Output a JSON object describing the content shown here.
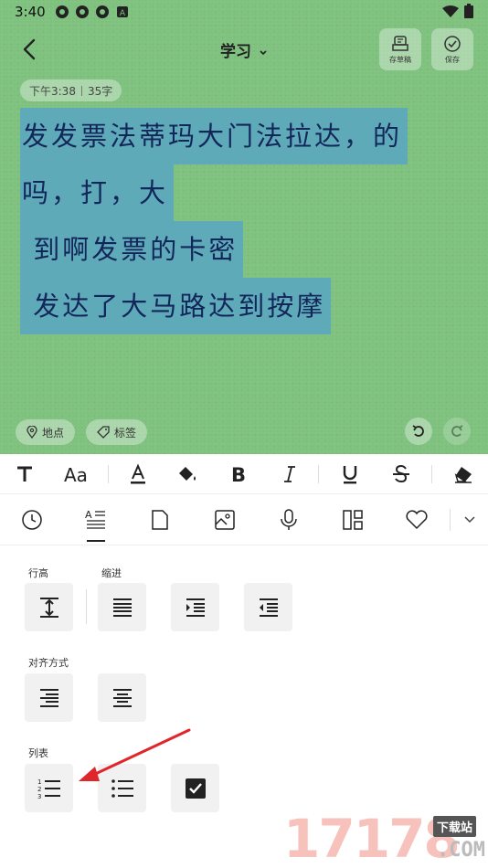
{
  "status_bar": {
    "time": "3:40"
  },
  "header": {
    "title": "学习",
    "draft_label": "存草稿",
    "save_label": "保存"
  },
  "note": {
    "time": "下午3:38",
    "char_count": "35字",
    "lines": [
      "发发票法蒂玛大门法拉达，的",
      "吗，打，大",
      " 到啊发票的卡密",
      " 发达了大马路达到按摩"
    ],
    "location_label": "地点",
    "tag_label": "标签"
  },
  "format_toolbar": {
    "items": [
      "text-style",
      "font-size",
      "font-color",
      "highlight",
      "bold",
      "italic",
      "underline",
      "strikethrough",
      "clear-format"
    ]
  },
  "tabs": [
    "clock",
    "paragraph-format",
    "page",
    "image",
    "voice",
    "layout",
    "favorite"
  ],
  "panel": {
    "line_height_label": "行高",
    "indent_label": "缩进",
    "align_label": "对齐方式",
    "list_label": "列表"
  },
  "watermark": {
    "number": "17178",
    "badge": "下载站",
    "domain": ".COM"
  },
  "colors": {
    "note_bg": "#7fc17f",
    "text_highlight": "#5faab9",
    "text_color": "#13265a",
    "arrow": "#e0262b"
  }
}
